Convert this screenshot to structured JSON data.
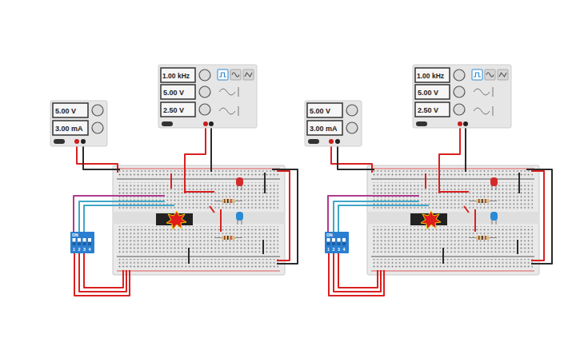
{
  "setups": [
    {
      "power_supply": {
        "voltage": "5.00 V",
        "current": "3.00 mA"
      },
      "function_generator": {
        "frequency": "1.00 kHz",
        "amplitude": "5.00 V",
        "offset": "2.50 V",
        "waveforms": [
          {
            "kind": "square",
            "selected": true
          },
          {
            "kind": "sine",
            "selected": false
          },
          {
            "kind": "triangle",
            "selected": false
          }
        ]
      },
      "dip_switch": {
        "label": "ON",
        "switches": [
          {
            "number": "1",
            "on": true
          },
          {
            "number": "2",
            "on": true
          },
          {
            "number": "3",
            "on": true
          },
          {
            "number": "4",
            "on": true
          }
        ]
      },
      "chip": {
        "burnt": true
      },
      "leds": [
        {
          "color": "#d42a2a"
        },
        {
          "color": "#2a8bd4"
        }
      ]
    },
    {
      "power_supply": {
        "voltage": "5.00 V",
        "current": "3.00 mA"
      },
      "function_generator": {
        "frequency": "1.00 kHz",
        "amplitude": "5.00 V",
        "offset": "2.50 V",
        "waveforms": [
          {
            "kind": "square",
            "selected": true
          },
          {
            "kind": "sine",
            "selected": false
          },
          {
            "kind": "triangle",
            "selected": false
          }
        ]
      },
      "dip_switch": {
        "label": "ON",
        "switches": [
          {
            "number": "1",
            "on": true
          },
          {
            "number": "2",
            "on": true
          },
          {
            "number": "3",
            "on": true
          },
          {
            "number": "4",
            "on": true
          }
        ]
      },
      "chip": {
        "burnt": true
      },
      "leds": [
        {
          "color": "#d42a2a"
        },
        {
          "color": "#2a8bd4"
        }
      ]
    }
  ]
}
